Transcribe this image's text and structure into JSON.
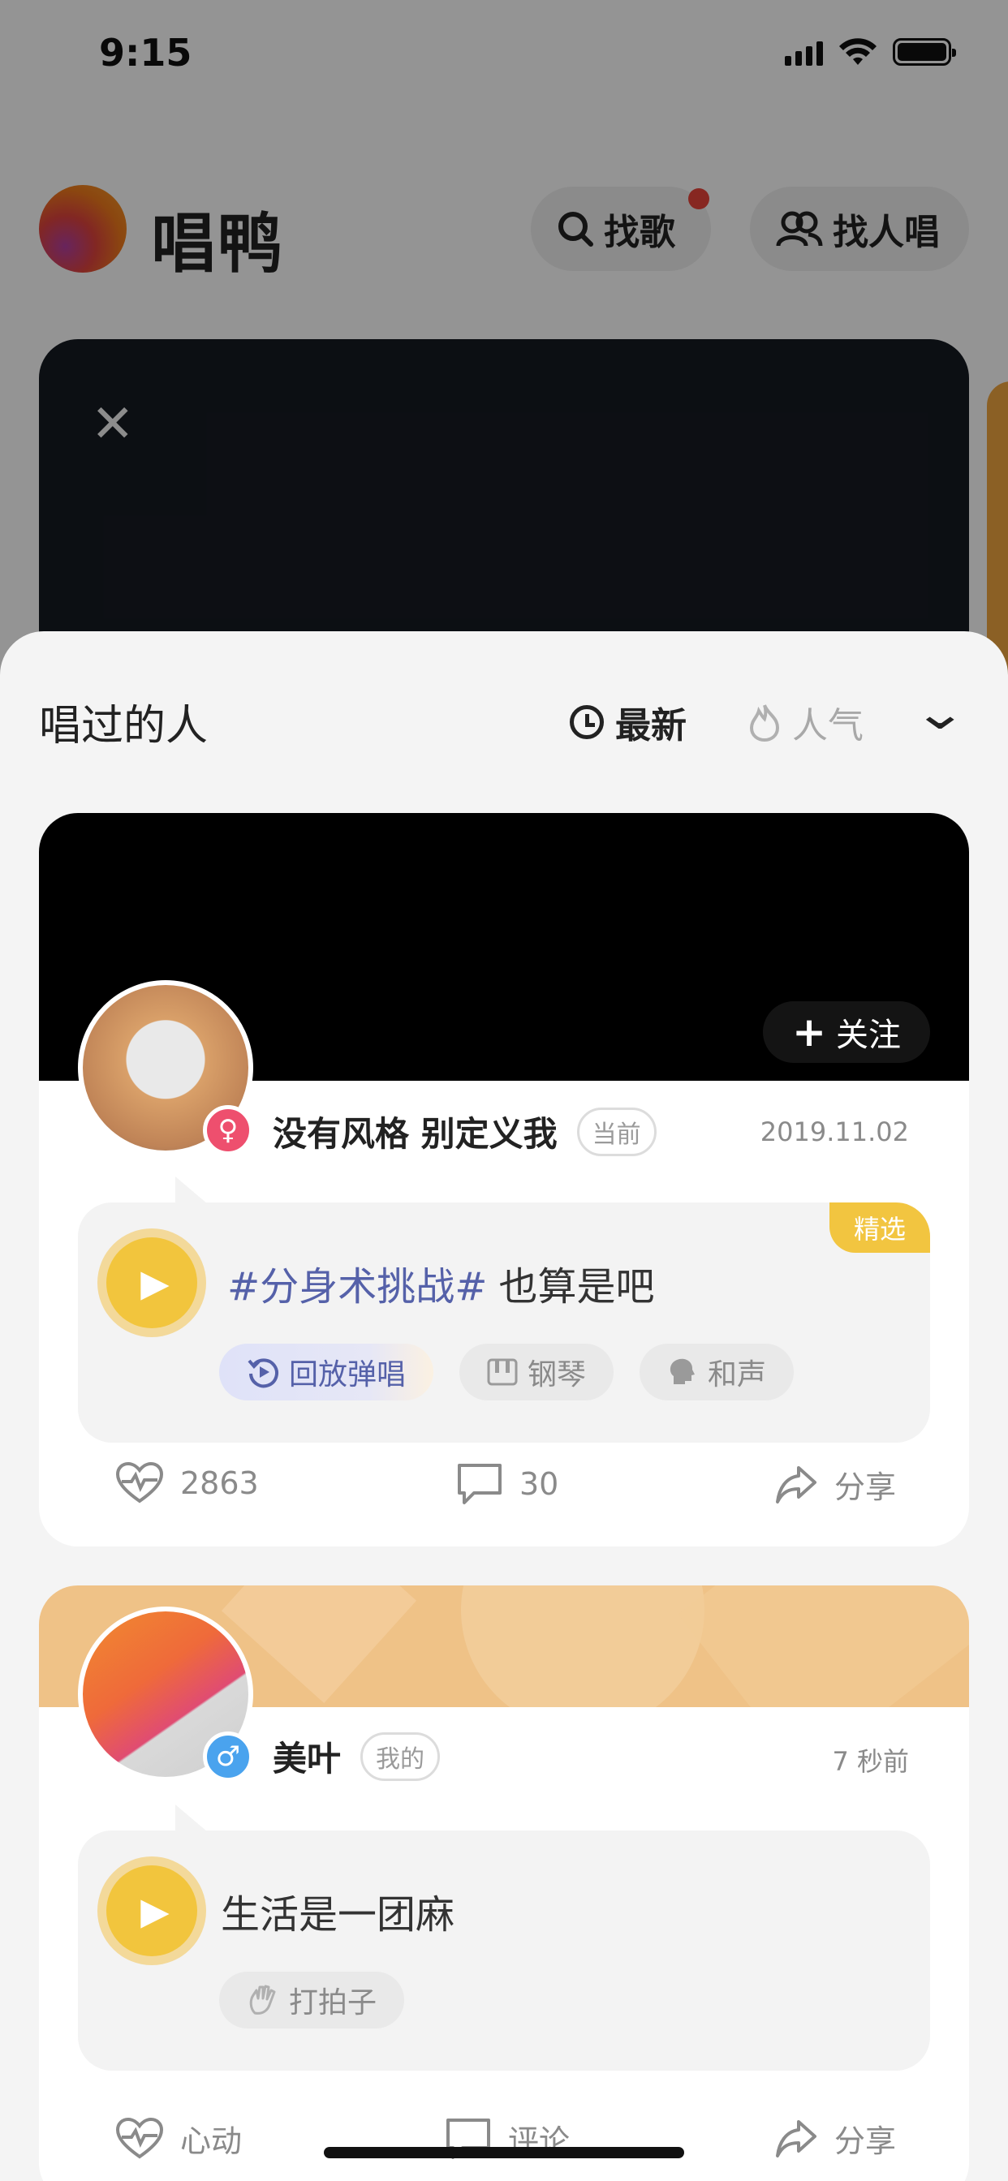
{
  "status_bar": {
    "time": "9:15",
    "signal_icon": "signal-icon",
    "wifi_icon": "wifi-icon",
    "battery_icon": "battery-icon"
  },
  "header": {
    "brand": "唱鸭",
    "find_song_label": "找歌",
    "find_people_label": "找人唱",
    "accent_color": "#F2C53D",
    "notification_color": "#E8443A"
  },
  "sheet": {
    "title": "唱过的人",
    "sort_latest": "最新",
    "sort_popular": "人气",
    "selected_sort": "最新"
  },
  "cards": [
    {
      "follow_label": "关注",
      "username": "没有风格 别定义我",
      "gender": "♀",
      "tag": "当前",
      "date": "2019.11.02",
      "badge": "精选",
      "hashtag": "#分身术挑战#",
      "song_text": "也算是吧",
      "chips": [
        "回放弹唱",
        "钢琴",
        "和声"
      ],
      "likes": "2863",
      "comments": "30",
      "share": "分享"
    },
    {
      "username": "美叶",
      "gender": "♂",
      "tag": "我的",
      "date": "7 秒前",
      "song_text": "生活是一团麻",
      "chips": [
        "打拍子"
      ],
      "likes": "心动",
      "comments": "评论",
      "share": "分享"
    }
  ]
}
